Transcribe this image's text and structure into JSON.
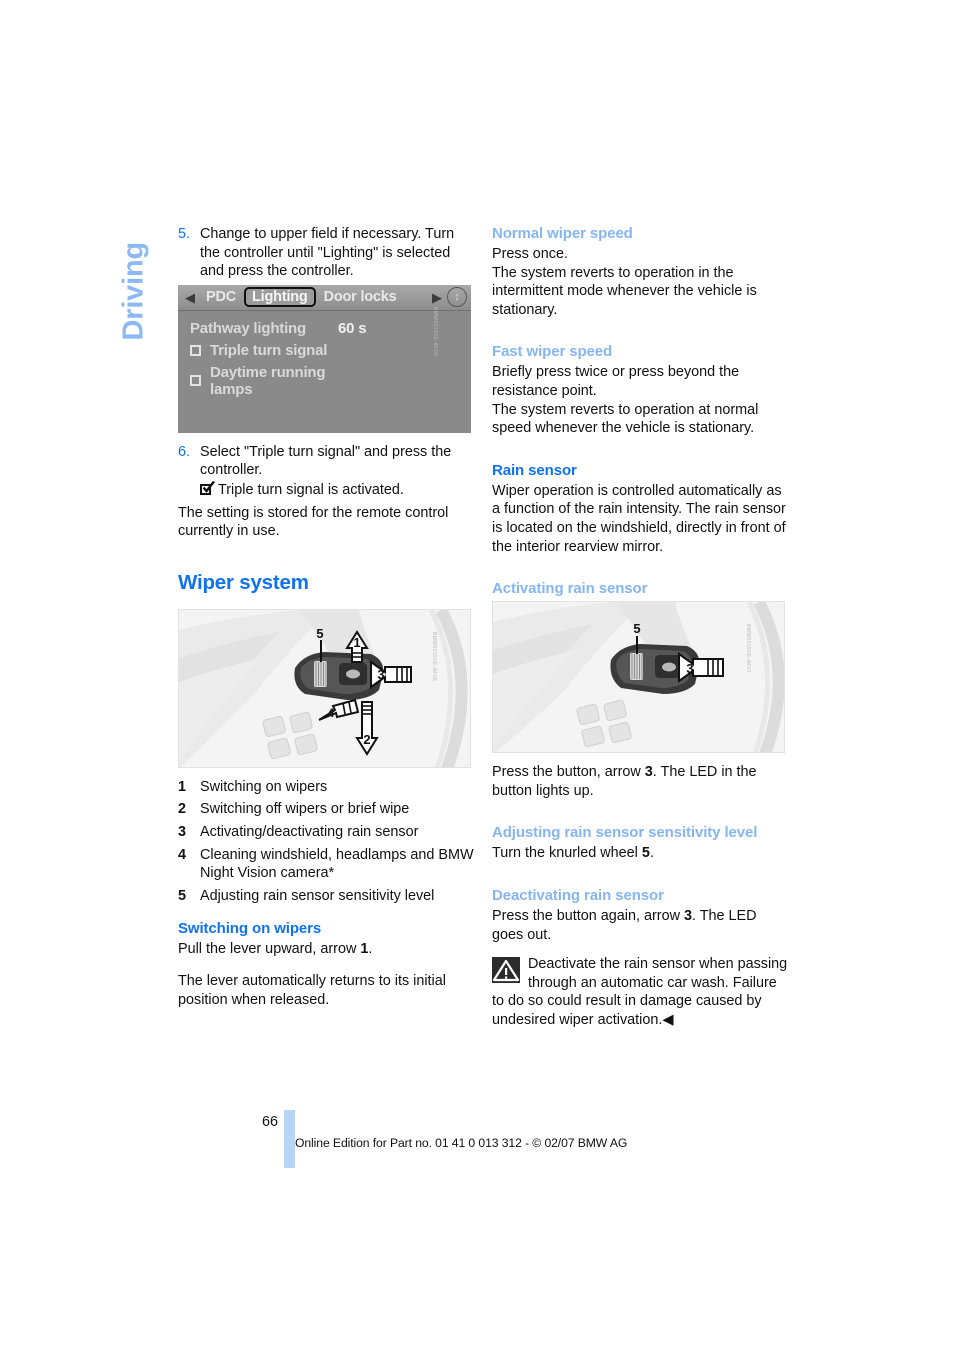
{
  "chapter": {
    "label": "Driving"
  },
  "left_column": {
    "steps": [
      {
        "num": "5.",
        "text": "Change to upper field if necessary. Turn the controller until \"Lighting\" is selected and press the controller."
      },
      {
        "num": "6.",
        "text": "Select \"Triple turn signal\" and press the controller.",
        "substep": "Triple turn signal is activated."
      }
    ],
    "after_steps": "The setting is stored for the remote control currently in use.",
    "idrive": {
      "left_arrow": "◀",
      "right_arrow": "▶",
      "indicator": "↕",
      "tabs": [
        "PDC",
        "Lighting",
        "Door locks"
      ],
      "selected_tab": "Lighting",
      "rows": [
        {
          "label": "Pathway lighting",
          "value": "60 s",
          "checkbox": false
        },
        {
          "label": "Triple turn signal",
          "value": "",
          "checkbox": true
        },
        {
          "label": "Daytime running lamps",
          "value": "",
          "checkbox": true
        }
      ],
      "fig_code": "BMW0015VE-AF05"
    },
    "section_title": "Wiper system",
    "figure_code": "BMW0015VE-AF06",
    "figure_labels": [
      "1",
      "2",
      "3",
      "4",
      "5"
    ],
    "legend": [
      {
        "num": "1",
        "text": "Switching on wipers"
      },
      {
        "num": "2",
        "text": "Switching off wipers or brief wipe"
      },
      {
        "num": "3",
        "text": "Activating/deactivating rain sensor"
      },
      {
        "num": "4",
        "text": "Cleaning windshield, headlamps and BMW Night Vision camera*"
      },
      {
        "num": "5",
        "text": "Adjusting rain sensor sensitivity level"
      }
    ],
    "switching_on": {
      "heading": "Switching on wipers",
      "p1_a": "Pull the lever upward, arrow ",
      "p1_b": "1",
      "p1_c": ".",
      "p2": "The lever automatically returns to its initial position when released."
    }
  },
  "right_column": {
    "normal_speed": {
      "heading": "Normal wiper speed",
      "p1": "Press once.",
      "p2": "The system reverts to operation in the intermittent mode whenever the vehicle is stationary."
    },
    "fast_speed": {
      "heading": "Fast wiper speed",
      "p1": "Briefly press twice or press beyond the resistance point.",
      "p2": "The system reverts to operation at normal speed whenever the vehicle is stationary."
    },
    "rain_sensor": {
      "heading": "Rain sensor",
      "p1": "Wiper operation is controlled automatically as a function of the rain intensity. The rain sensor is located on the windshield, directly in front of the interior rearview mirror."
    },
    "activating": {
      "heading": "Activating rain sensor",
      "figure_code": "BMW0015VE-AF07",
      "figure_labels": [
        "3",
        "5"
      ],
      "p1_a": "Press the button, arrow ",
      "p1_b": "3",
      "p1_c": ". The LED in the button lights up."
    },
    "adjusting": {
      "heading": "Adjusting rain sensor sensitivity level",
      "p1_a": "Turn the knurled wheel ",
      "p1_b": "5",
      "p1_c": "."
    },
    "deactivating": {
      "heading": "Deactivating rain sensor",
      "p1_a": "Press the button again, arrow ",
      "p1_b": "3",
      "p1_c": ". The LED goes out."
    },
    "warning": {
      "text": "Deactivate the rain sensor when passing through an automatic car wash. Failure to do so could result in damage caused by undesired wiper activation.",
      "end_marker": "◀"
    }
  },
  "footer": {
    "page_number": "66",
    "edition_line": "Online Edition for Part no. 01 41 0 013 312 - © 02/07 BMW AG"
  },
  "colors": {
    "heading_blue": "#0f73f0",
    "subheading_blue": "#86b6f2",
    "tab_blue": "#8cb9f2",
    "page_bar_blue": "#b8d4f7"
  }
}
